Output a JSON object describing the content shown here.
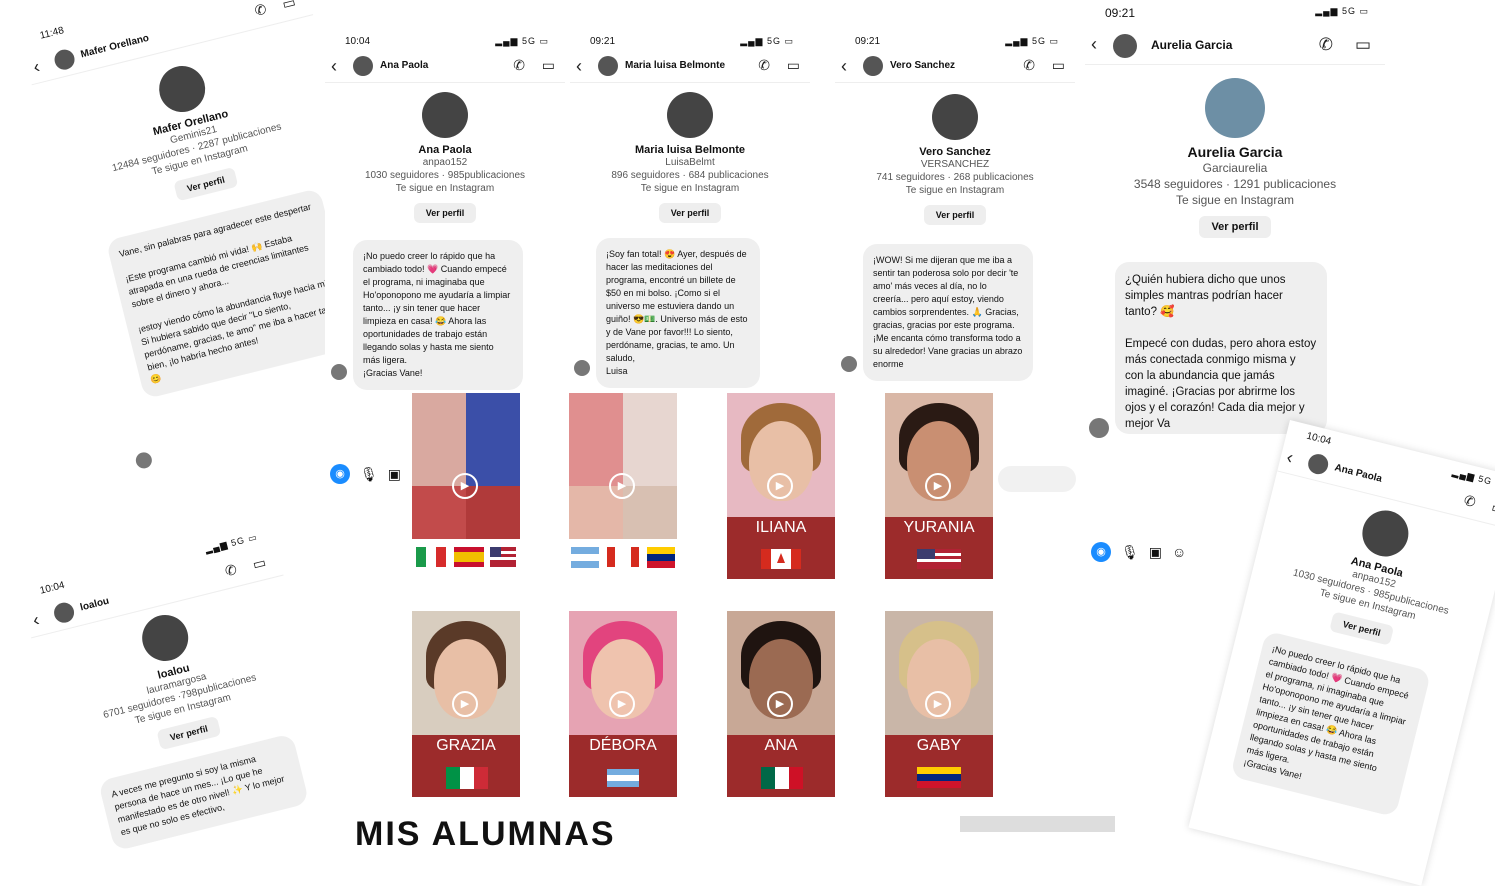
{
  "cards": {
    "mafer": {
      "time": "11:48",
      "signal": "5G",
      "header_name": "Mafer Orellano",
      "profile_name": "Mafer Orellano",
      "username": "Geminis21",
      "stats": "12484 seguidores · 2287 publicaciones",
      "follow": "Te sigue en Instagram",
      "view": "Ver perfil",
      "message": "Vane, sin palabras para agradecer este despertar\n\n¡Este programa cambió mi vida! 🙌 Estaba atrapada en una rueda de creencias limitantes sobre el dinero y ahora...\n\n¡estoy viendo cómo la abundancia fluye hacia mí! Si hubiera sabido que decir \"Lo siento, perdóname, gracias, te amo\" me iba a hacer tanto bien, ¡lo habría hecho antes!\n😊"
    },
    "loalou": {
      "time": "10:04",
      "signal": "5G",
      "header_name": "loalou",
      "profile_name": "loalou",
      "username": "lauramargosa",
      "stats": "6701 seguidores ·798publicaciones",
      "follow": "Te sigue en Instagram",
      "view": "Ver perfil",
      "message": "A veces me pregunto si soy la misma persona de hace un mes... ¡Lo que he manifestado es de otro nivel! ✨ Y lo mejor es que no solo es efectivo,"
    },
    "ana": {
      "time": "10:04",
      "signal": "5G",
      "header_name": "Ana Paola",
      "profile_name": "Ana Paola",
      "username": "anpao152",
      "stats": "1030 seguidores · 985publicaciones",
      "follow": "Te sigue en Instagram",
      "view": "Ver perfil",
      "message": "¡No puedo creer lo rápido que ha cambiado todo! 💗 Cuando empecé el programa, ni imaginaba que Ho'oponopono me ayudaría a limpiar tanto... ¡y sin tener que hacer limpieza en casa! 😂 Ahora las oportunidades de trabajo están llegando solas y hasta me siento más ligera.\n¡Gracias  Vane!"
    },
    "maria": {
      "time": "09:21",
      "signal": "5G",
      "header_name": "Maria luisa Belmonte",
      "profile_name": "Maria luisa Belmonte",
      "username": "LuisaBelmt",
      "stats": "896 seguidores · 684 publicaciones",
      "follow": "Te sigue en Instagram",
      "view": "Ver perfil",
      "message": "¡Soy fan total! 😍 Ayer, después de hacer las meditaciones del programa, encontré un billete de $50 en mi bolso. ¡Como si el universo me estuviera dando un guiño! 😎💵. Universo más de esto y de Vane por favor!!! Lo siento, perdóname, gracias, te amo.  Un saludo,\nLuisa"
    },
    "vero": {
      "time": "09:21",
      "signal": "5G",
      "header_name": "Vero Sanchez",
      "profile_name": "Vero Sanchez",
      "username": "VERSANCHEZ",
      "stats": "741 seguidores · 268 publicaciones",
      "follow": "Te sigue en Instagram",
      "view": "Ver perfil",
      "message": "¡WOW! Si me dijeran que me iba a sentir tan poderosa solo por decir 'te amo' más veces al día, no lo creería... pero aquí estoy, viendo cambios sorprendentes. 🙏 Gracias, gracias, gracias por este programa. ¡Me encanta cómo transforma todo a su alrededor! Vane  gracias un abrazo enorme"
    },
    "aurelia": {
      "time": "09:21",
      "signal": "5G",
      "header_name": "Aurelia Garcia",
      "profile_name": "Aurelia Garcia",
      "username": "Garciaurelia",
      "stats": "3548 seguidores · 1291 publicaciones",
      "follow": "Te sigue en Instagram",
      "view": "Ver perfil",
      "message": "¿Quién hubiera dicho que unos simples mantras podrían hacer tanto? 🥰\n\nEmpecé con dudas, pero ahora estoy más conectada conmigo misma y con la abundancia que jamás imaginé. ¡Gracias por abrirme los ojos y el corazón! Cada dia mejor y mejor Va"
    },
    "ana2": {
      "time": "10:04",
      "signal": "5G",
      "header_name": "Ana Paola",
      "profile_name": "Ana Paola",
      "username": "anpao152",
      "stats": "1030 seguidores · 985publicaciones",
      "follow": "Te sigue en Instagram",
      "view": "Ver perfil",
      "message": "¡No puedo creer lo rápido que ha cambiado todo! 💗 Cuando empecé el programa, ni imaginaba que Ho'oponopono me ayudaría a limpiar tanto... ¡y sin tener que hacer limpieza en casa! 😂 Ahora las oportunidades de trabajo están llegando solas y hasta me siento más ligera.\n¡Gracias  Vane!"
    }
  },
  "tiles": [
    {
      "label": "",
      "flag": "it-es-us"
    },
    {
      "label": "",
      "flag": "ar-ca-ve"
    },
    {
      "label": "ILIANA",
      "flag": "us-ca"
    },
    {
      "label": "YURANIA",
      "flag": "us"
    },
    {
      "label": "GRAZIA",
      "flag": "it"
    },
    {
      "label": "DÉBORA",
      "flag": "ar"
    },
    {
      "label": "ANA",
      "flag": "mx"
    },
    {
      "label": "GABY",
      "flag": "ve"
    }
  ],
  "icons": {
    "camera": "camera-icon",
    "mic": "mic-icon",
    "image": "image-icon",
    "sticker": "sticker-icon"
  },
  "colors": {
    "band": "#9c2b2b",
    "accent": "#1a8cff",
    "bubble": "#efefef"
  },
  "footer": {
    "title": "MIS ALUMNAS"
  }
}
